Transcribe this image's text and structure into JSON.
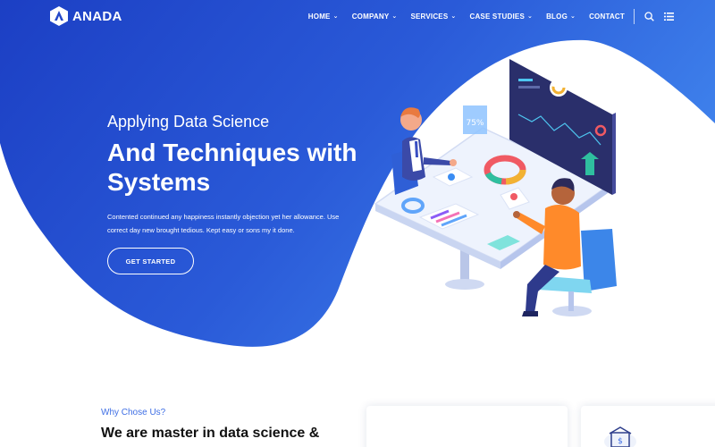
{
  "brand": {
    "name": "ANADA"
  },
  "nav": {
    "items": [
      {
        "label": "HOME",
        "has_dropdown": true
      },
      {
        "label": "COMPANY",
        "has_dropdown": true
      },
      {
        "label": "SERVICES",
        "has_dropdown": true
      },
      {
        "label": "CASE STUDIES",
        "has_dropdown": true
      },
      {
        "label": "BLOG",
        "has_dropdown": true
      },
      {
        "label": "CONTACT",
        "has_dropdown": false
      }
    ],
    "dropdown_glyph": "⌄",
    "icons": [
      "search-icon",
      "menu-list-icon"
    ]
  },
  "hero": {
    "subtitle": "Applying Data Science",
    "title": "And Techniques with Systems",
    "description": "Contented continued any happiness instantly objection yet her allowance. Use correct day new brought tedious. Kept easy or sons my it done.",
    "cta_label": "GET STARTED",
    "illustration": {
      "percent_badge": "75%"
    }
  },
  "why": {
    "label": "Why Chose Us?",
    "heading": "We are master in data science &"
  },
  "colors": {
    "hero_gradient_start": "#1f47c9",
    "hero_gradient_end": "#3a7be9",
    "accent": "#3f6fe5",
    "text_dark": "#111111"
  }
}
